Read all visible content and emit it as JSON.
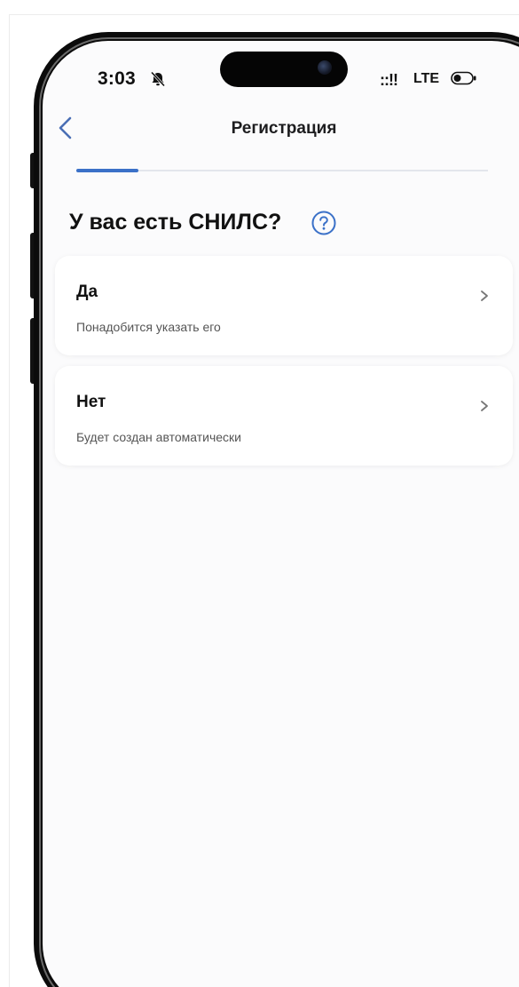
{
  "status_bar": {
    "time": "3:03",
    "signal_glyph": "::!!",
    "network": "LTE",
    "icons": [
      "bell-slash-icon",
      "signal-icon",
      "battery-icon"
    ]
  },
  "nav": {
    "title": "Регистрация",
    "back_icon": "chevron-left-icon"
  },
  "progress": {
    "fraction": 0.15,
    "accent_color": "#3b71c8"
  },
  "question": {
    "text": "У вас есть СНИЛС?",
    "help_icon": "question-circle-icon"
  },
  "options": [
    {
      "title": "Да",
      "subtitle": "Понадобится указать его"
    },
    {
      "title": "Нет",
      "subtitle": "Будет создан автоматически"
    }
  ],
  "colors": {
    "accent": "#3b71c8",
    "background": "#fbfbfc",
    "card": "#ffffff"
  }
}
